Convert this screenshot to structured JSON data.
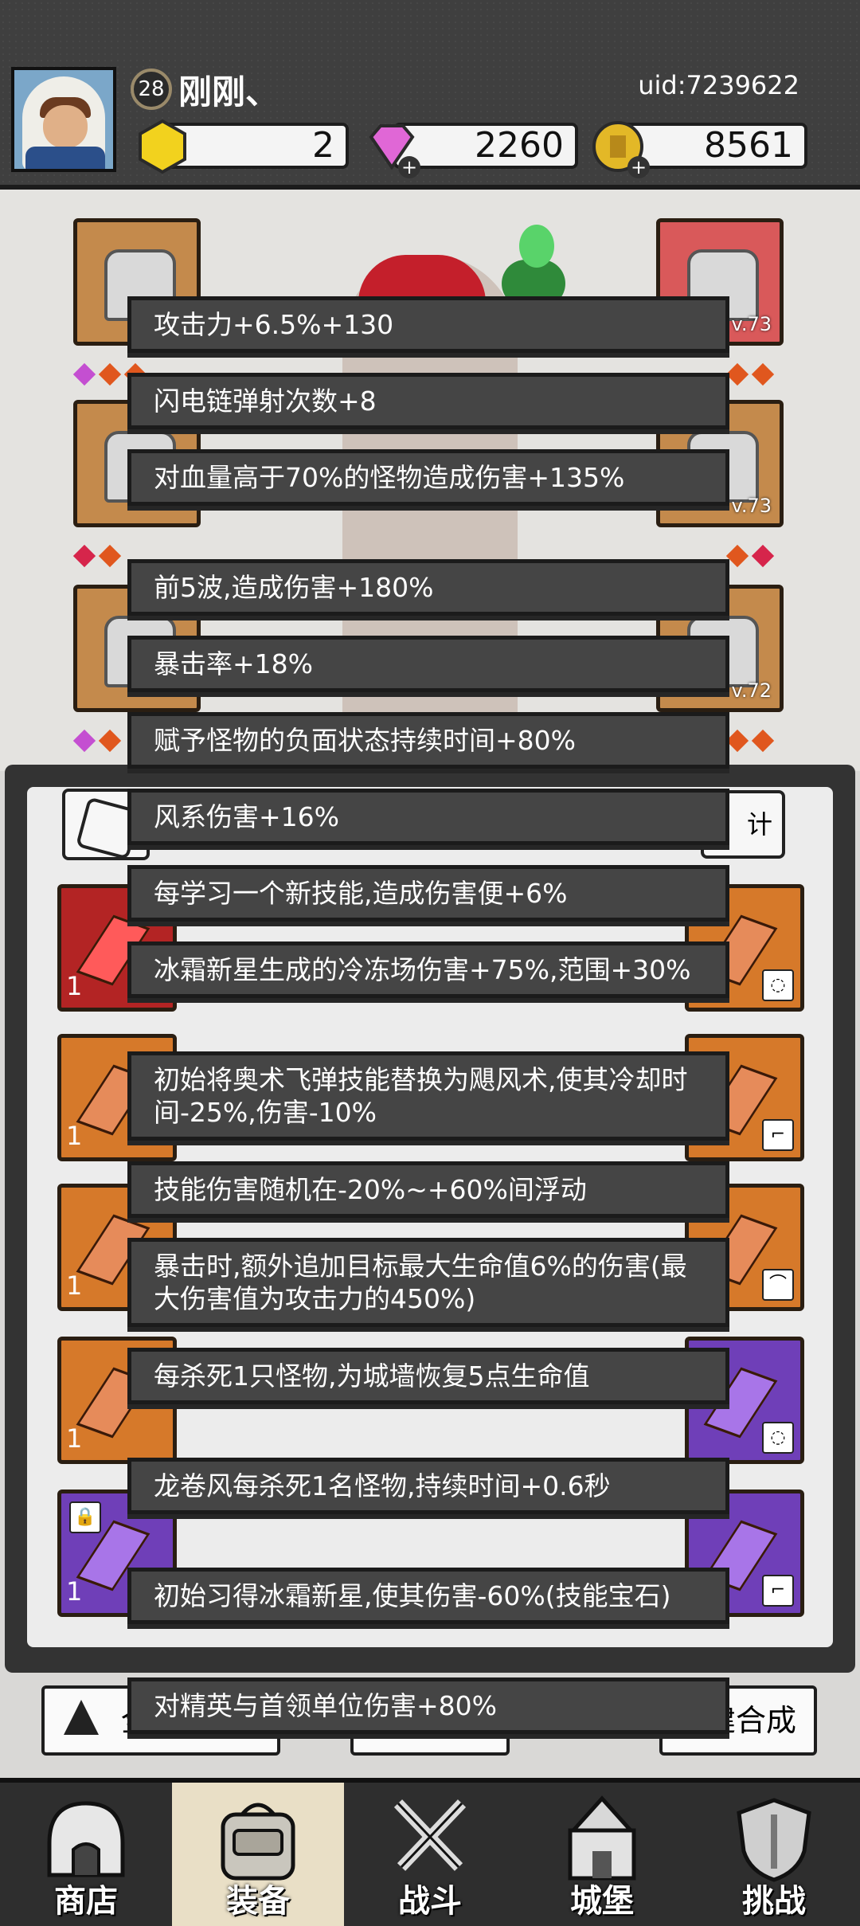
{
  "player": {
    "level": "28",
    "name": "刚刚、",
    "uid": "uid:7239622"
  },
  "currencies": [
    {
      "icon": "gold-hex-icon",
      "value": "2"
    },
    {
      "icon": "diamond-icon",
      "value": "2260"
    },
    {
      "icon": "coin-icon",
      "value": "8561"
    }
  ],
  "equipment": {
    "levels": [
      "v.73",
      "v.73",
      "v.72"
    ]
  },
  "inventory": {
    "stats_button_visible_text": "计",
    "tile_count": "1"
  },
  "bottom_buttons": {
    "left_visible_text": "全",
    "right_visible_text": "建合成"
  },
  "tooltip": {
    "effects": [
      "攻击力+6.5%+130",
      "闪电链弹射次数+8",
      "对血量高于70%的怪物造成伤害+135%",
      "前5波,造成伤害+180%",
      "暴击率+18%",
      "赋予怪物的负面状态持续时间+80%",
      "风系伤害+16%",
      "每学习一个新技能,造成伤害便+6%",
      "冰霜新星生成的冷冻场伤害+75%,范围+30%",
      "初始将奥术飞弹技能替换为飓风术,使其冷却时间-25%,伤害-10%",
      "技能伤害随机在-20%~+60%间浮动",
      "暴击时,额外追加目标最大生命值6%的伤害(最大伤害值为攻击力的450%)",
      "每杀死1只怪物,为城墙恢复5点生命值",
      "龙卷风每杀死1名怪物,持续时间+0.6秒",
      "初始习得冰霜新星,使其伤害-60%(技能宝石)",
      "对精英与首领单位伤害+80%"
    ]
  },
  "nav": [
    {
      "label": "商店",
      "icon": "shop-icon"
    },
    {
      "label": "装备",
      "icon": "backpack-icon",
      "active": true
    },
    {
      "label": "战斗",
      "icon": "crossed-swords-icon"
    },
    {
      "label": "城堡",
      "icon": "castle-icon"
    },
    {
      "label": "挑战",
      "icon": "shield-icon"
    }
  ],
  "colors": {
    "tooltip_bg": "#454545",
    "topbar_bg": "#3f3f3f",
    "nav_active": "#e9dfc6"
  }
}
